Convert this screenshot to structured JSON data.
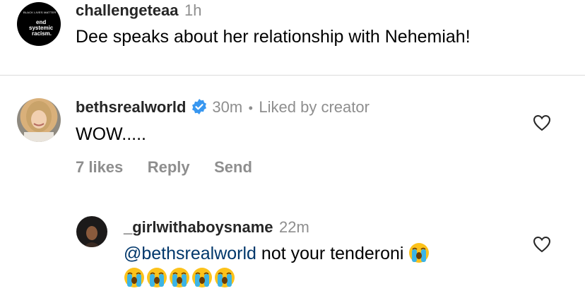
{
  "caption": {
    "username": "challengeteaa",
    "time": "1h",
    "text": "Dee speaks about her relationship with Nehemiah!",
    "avatar_text": {
      "line1": "BLACK LIVES MATTER",
      "line2": "end",
      "line3": "systemic",
      "line4": "racism."
    }
  },
  "comment": {
    "username": "bethsrealworld",
    "verified": true,
    "time": "30m",
    "separator": "•",
    "liked_by": "Liked by creator",
    "text": "WOW.....",
    "likes": "7 likes",
    "reply": "Reply",
    "send": "Send"
  },
  "reply": {
    "username": "_girlwithaboysname",
    "time": "22m",
    "mention": "@bethsrealworld",
    "text": " not your tenderoni",
    "emoji_name": "loudly-crying-face"
  },
  "colors": {
    "mention": "#00376b",
    "verified": "#3897f0",
    "meta": "#8e8e8e",
    "divider": "#dbdbdb"
  },
  "icons": [
    "heart-icon",
    "verified-badge-icon",
    "loudly-crying-face-emoji"
  ]
}
